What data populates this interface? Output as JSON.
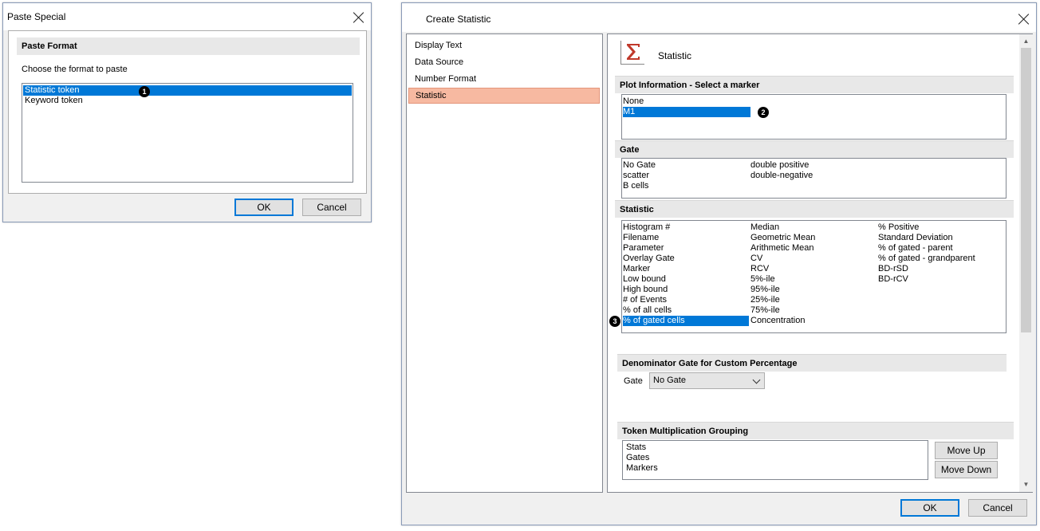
{
  "paste_special": {
    "title": "Paste Special",
    "group_title": "Paste Format",
    "prompt": "Choose the format to paste",
    "items": [
      "Statistic token",
      "Keyword token"
    ],
    "selected_index": 0,
    "badge": "1",
    "ok_label": "OK",
    "cancel_label": "Cancel"
  },
  "create_statistic": {
    "title": "Create Statistic",
    "nav": [
      "Display Text",
      "Data Source",
      "Number Format",
      "Statistic"
    ],
    "active_nav_index": 3,
    "header_label": "Statistic",
    "header_icon": "sigma-icon",
    "plot_info": {
      "title": "Plot Information - Select a marker",
      "items": [
        "None",
        "M1"
      ],
      "selected_index": 1,
      "badge": "2"
    },
    "gate": {
      "title": "Gate",
      "col1": [
        "No Gate",
        "scatter",
        "B cells"
      ],
      "col2": [
        "double positive",
        "double-negative"
      ]
    },
    "statistic": {
      "title": "Statistic",
      "col1": [
        "Histogram #",
        "Filename",
        "Parameter",
        "Overlay Gate",
        "Marker",
        "Low bound",
        "High bound",
        "# of Events",
        "% of all cells",
        "% of gated cells"
      ],
      "col2": [
        "Median",
        "Geometric Mean",
        "Arithmetic Mean",
        "CV",
        "RCV",
        "5%-ile",
        "95%-ile",
        "25%-ile",
        "75%-ile",
        "Concentration"
      ],
      "col3": [
        "% Positive",
        "Standard Deviation",
        "% of gated - parent",
        "% of gated - grandparent",
        "BD-rSD",
        "BD-rCV"
      ],
      "selected": "% of gated cells",
      "badge": "3"
    },
    "denominator": {
      "title": "Denominator Gate for Custom Percentage",
      "gate_label": "Gate",
      "gate_value": "No Gate"
    },
    "token_grouping": {
      "title": "Token Multiplication Grouping",
      "items": [
        "Stats",
        "Gates",
        "Markers"
      ],
      "move_up_label": "Move Up",
      "move_down_label": "Move Down"
    },
    "ok_label": "OK",
    "cancel_label": "Cancel"
  },
  "colors": {
    "selection": "#0078d7",
    "active_nav": "#f7b9a1",
    "sigma": "#c0392b"
  }
}
